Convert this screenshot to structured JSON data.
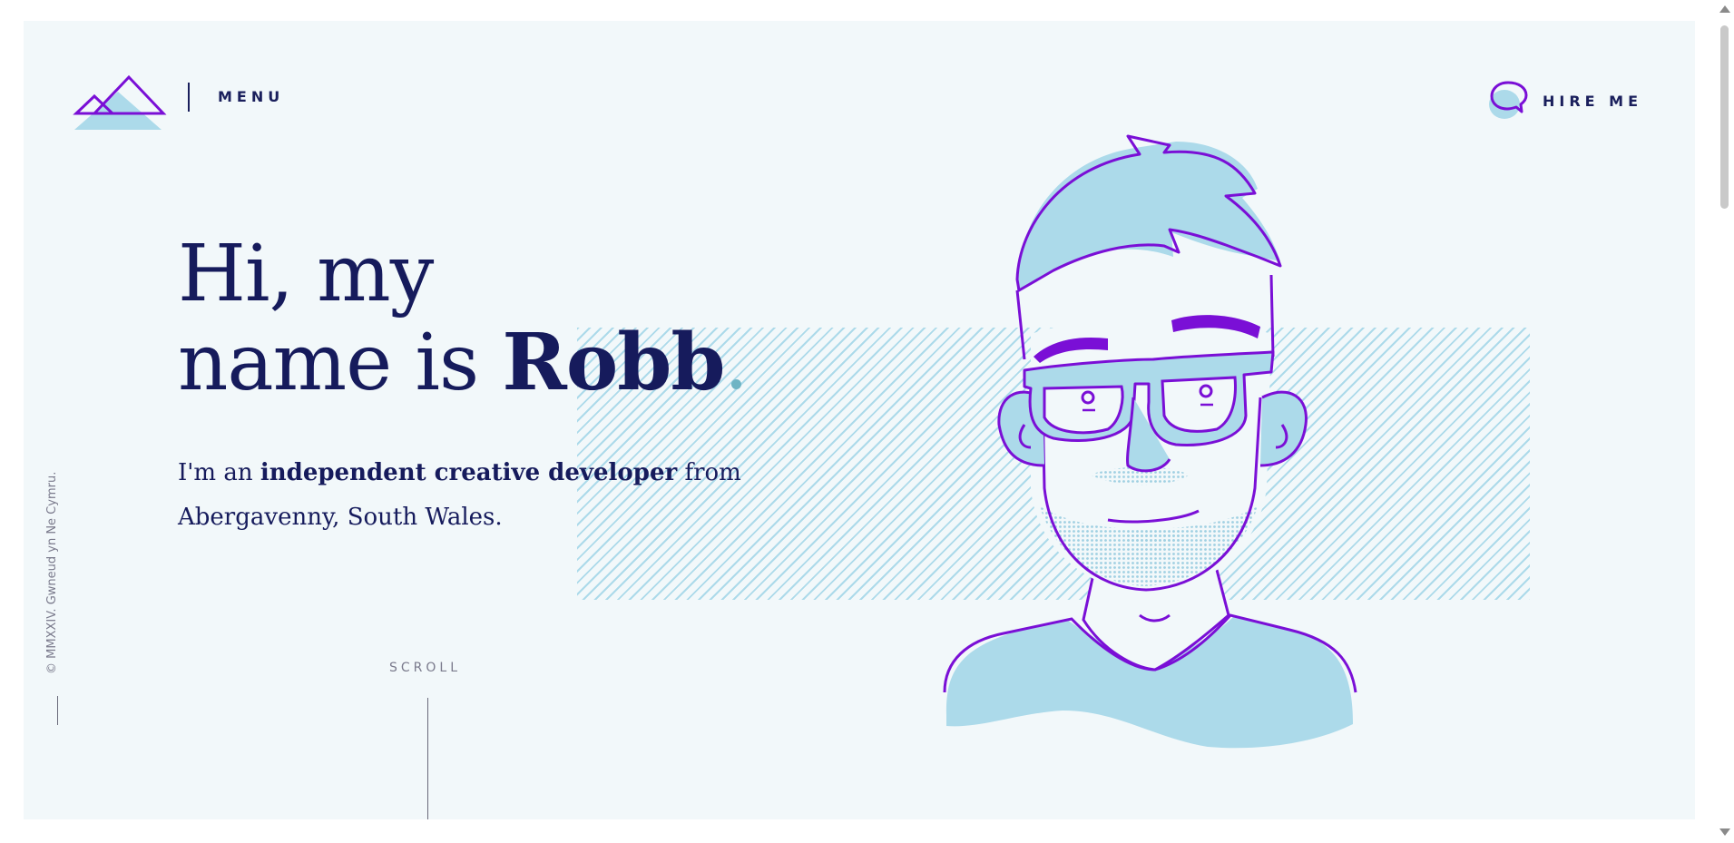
{
  "header": {
    "menu_label": "MENU",
    "hire_label": "HIRE ME"
  },
  "hero": {
    "heading_line1": "Hi, my",
    "heading_line2_prefix": "name is ",
    "heading_name": "Robb",
    "intro_prefix": "I'm an ",
    "intro_bold": "independent creative developer",
    "intro_suffix": " from",
    "intro_line2": "Abergavenny, South Wales."
  },
  "sidebar": {
    "copyright": "© MMXXIV. Gwneud yn Ne Cymru."
  },
  "scroll_label": "SCROLL",
  "icons": {
    "logo": "mountains-logo-icon",
    "hire": "speech-bubble-icon",
    "portrait": "developer-portrait-illustration"
  },
  "colors": {
    "background": "#f2f8fa",
    "navy": "#161b5c",
    "purple": "#7a0fd6",
    "light_blue": "#acdaea",
    "accent_dot": "#6fb4c4"
  }
}
